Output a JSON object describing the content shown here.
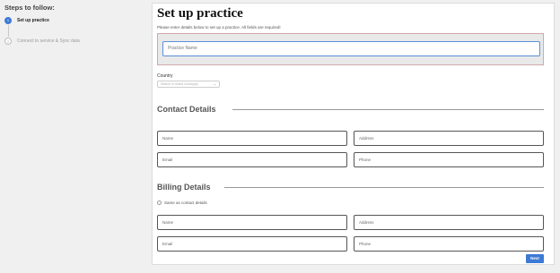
{
  "sidebar": {
    "title": "Steps to follow:",
    "steps": [
      {
        "number": "1",
        "label": "Set up practice"
      },
      {
        "number": "2",
        "label": "Connect to service & Sync data"
      }
    ]
  },
  "main": {
    "title": "Set up practice",
    "subtitle": "Please enter details below to set up a practice. All fields are required!",
    "practice_name_placeholder": "Practice Name",
    "country": {
      "label": "Country",
      "placeholder": "Search or select country(s)"
    },
    "contact": {
      "title": "Contact Details",
      "name": "Name",
      "address": "Address",
      "email": "Email",
      "phone": "Phone"
    },
    "billing": {
      "title": "Billing Details",
      "same_as_contact": "Same as contact details",
      "name": "Name",
      "address": "Address",
      "email": "Email",
      "phone": "Phone"
    },
    "next_label": "Next"
  },
  "colors": {
    "accent": "#3d7ad6",
    "error_border": "#d0a8aa"
  }
}
